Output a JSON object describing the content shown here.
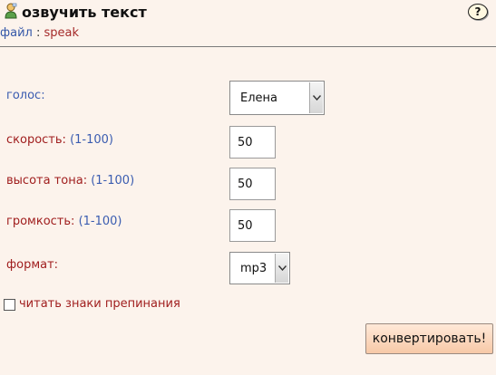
{
  "header": {
    "title": "озвучить текст",
    "breadcrumb": {
      "parent": "файл",
      "separator": ":",
      "current": "speak"
    },
    "help_label": "?"
  },
  "form": {
    "voice": {
      "label": "голос:",
      "value": "Елена"
    },
    "speed": {
      "label": "скорость:",
      "range": "(1-100)",
      "value": "50"
    },
    "pitch": {
      "label": "высота тона:",
      "range": "(1-100)",
      "value": "50"
    },
    "volume": {
      "label": "громкость:",
      "range": "(1-100)",
      "value": "50"
    },
    "format": {
      "label": "формат:",
      "value": "mp3"
    },
    "punctuation": {
      "label": "читать знаки препинания",
      "checked": false
    }
  },
  "actions": {
    "convert_label": "конвертировать!"
  },
  "colors": {
    "background": "#fcf3ec",
    "label_blue": "#3a5cb0",
    "label_red": "#a01e1e",
    "button": "#f7c9a7"
  }
}
